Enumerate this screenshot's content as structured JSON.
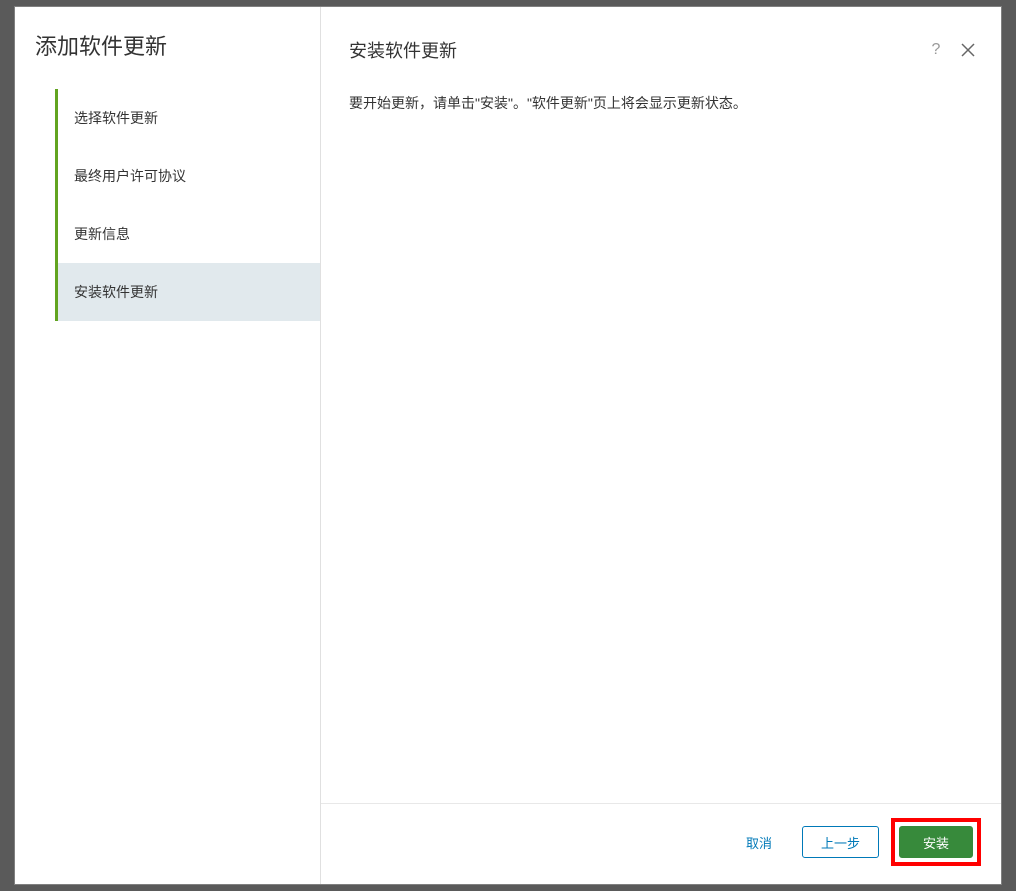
{
  "sidebar": {
    "title": "添加软件更新",
    "steps": [
      {
        "label": "选择软件更新"
      },
      {
        "label": "最终用户许可协议"
      },
      {
        "label": "更新信息"
      },
      {
        "label": "安装软件更新"
      }
    ]
  },
  "main": {
    "title": "安装软件更新",
    "description": "要开始更新，请单击\"安装\"。\"软件更新\"页上将会显示更新状态。"
  },
  "footer": {
    "cancel": "取消",
    "back": "上一步",
    "install": "安装"
  }
}
